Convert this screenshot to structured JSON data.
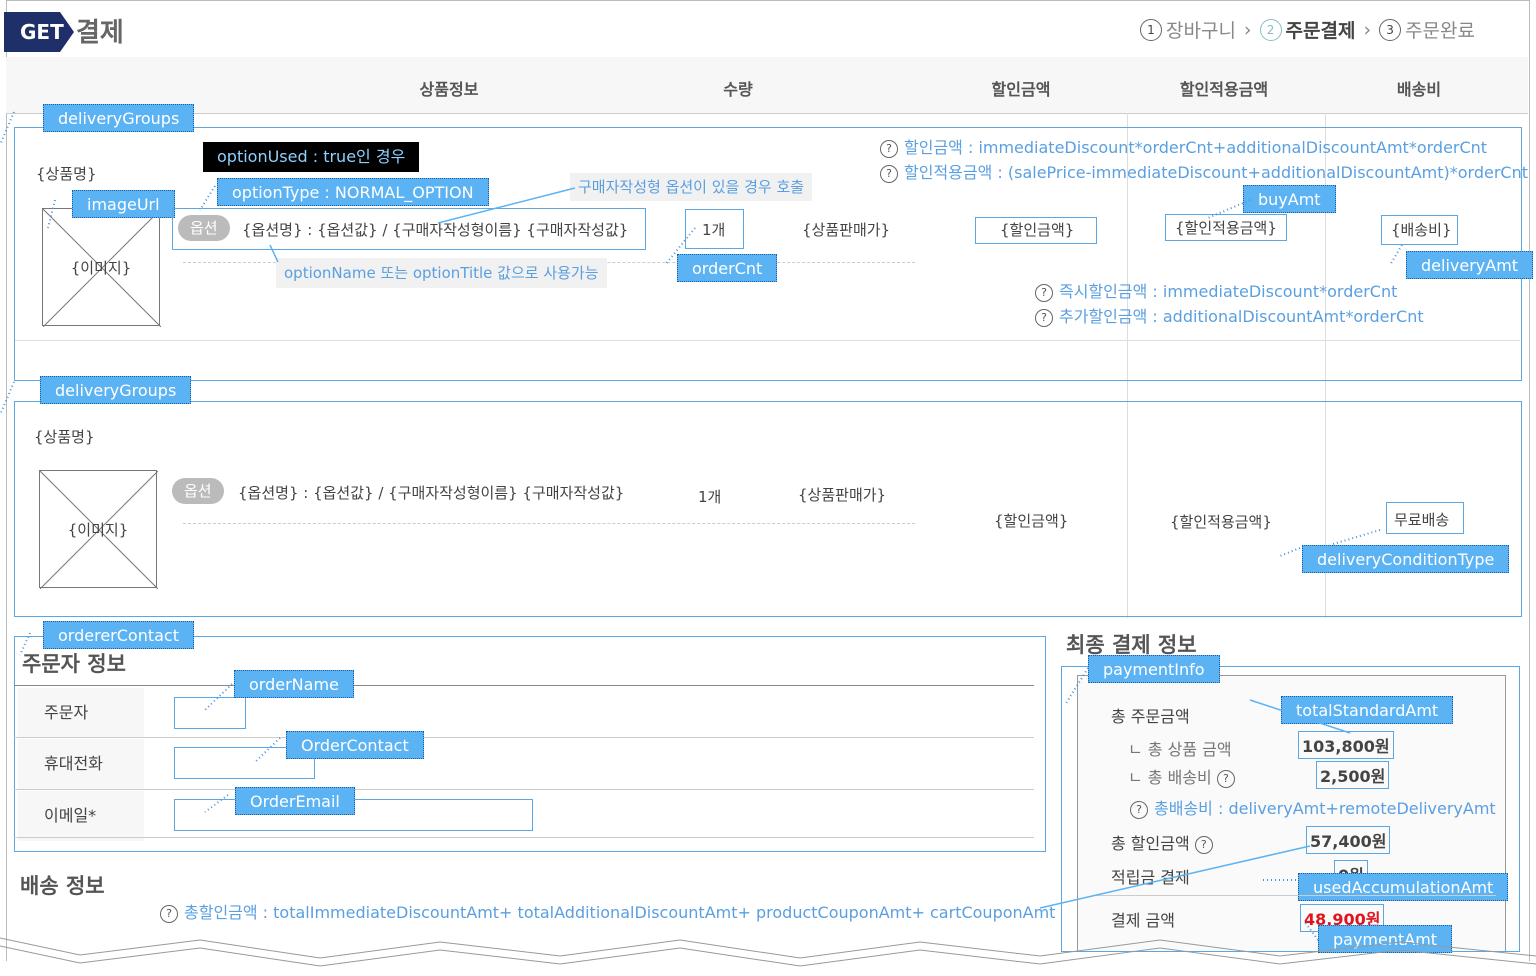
{
  "header": {
    "method_badge": "GET",
    "title": "결제",
    "steps": [
      {
        "num": "1",
        "label": "장바구니"
      },
      {
        "num": "2",
        "label": "주문결제"
      },
      {
        "num": "3",
        "label": "주문완료"
      }
    ]
  },
  "columns": [
    "상품정보",
    "수량",
    "할인금액",
    "할인적용금액",
    "배송비"
  ],
  "group1": {
    "tag": "deliveryGroups",
    "product_name": "{상품명}",
    "image_label": "{이미지}",
    "image_tag": "imageUrl",
    "option_used_note": "optionUsed : true인 경우",
    "option_type_tag": "optionType : NORMAL_OPTION",
    "custom_option_note": "구매자작성형 옵션이 있을 경우 호출",
    "option_pill": "옵션",
    "option_text": "{옵션명} : {옵션값} / {구매자작성형이름} {구매자작성값}",
    "option_name_note": "optionName 또는 optionTitle 값으로 사용가능",
    "qty": "1개",
    "qty_tag": "orderCnt",
    "sale_price": "{상품판매가}",
    "discount": "{할인금액}",
    "applied": "{할인적용금액}",
    "buy_tag": "buyAmt",
    "delivery": "{배송비}",
    "delivery_tag": "deliveryAmt",
    "notes": [
      "할인금액 : immediateDiscount*orderCnt+additionalDiscountAmt*orderCnt",
      "할인적용금액 : (salePrice-immediateDiscount+additionalDiscountAmt)*orderCnt"
    ],
    "discount_notes": [
      "즉시할인금액 : immediateDiscount*orderCnt",
      "추가할인금액 : additionalDiscountAmt*orderCnt"
    ]
  },
  "group2": {
    "tag": "deliveryGroups",
    "product_name": "{상품명}",
    "image_label": "{이미지}",
    "option_pill": "옵션",
    "option_text": "{옵션명} : {옵션값} / {구매자작성형이름} {구매자작성값}",
    "qty": "1개",
    "sale_price": "{상품판매가}",
    "discount": "{할인금액}",
    "applied": "{할인적용금액}",
    "free_delivery": "무료배송",
    "condition_tag": "deliveryConditionType"
  },
  "orderer": {
    "tag": "ordererContact",
    "title": "주문자 정보",
    "rows": [
      {
        "label": "주문자",
        "tag": "orderName"
      },
      {
        "label": "휴대전화",
        "tag": "OrderContact"
      },
      {
        "label": "이메일*",
        "tag": "OrderEmail"
      }
    ]
  },
  "shipping": {
    "title": "배송 정보",
    "total_discount_note": "총할인금액 : totalImmediateDiscountAmt+ totalAdditionalDiscountAmt+ productCouponAmt+ cartCouponAmt"
  },
  "payment": {
    "title": "최종 결제 정보",
    "tag": "paymentInfo",
    "total_order_label": "총 주문금액",
    "total_standard_tag": "totalStandardAmt",
    "product_amount_label": "ㄴ 총 상품 금액",
    "product_amount": "103,800원",
    "delivery_label": "ㄴ 총 배송비",
    "delivery_amount": "2,500원",
    "delivery_note": "총배송비 : deliveryAmt+remoteDeliveryAmt",
    "discount_label": "총 할인금액",
    "discount_amount": "57,400원",
    "accum_label": "적립금 결제",
    "accum_amount": "0원",
    "accum_tag": "usedAccumulationAmt",
    "pay_label": "결제 금액",
    "pay_amount": "48,900원",
    "pay_tag": "paymentAmt",
    "pay_color": "#e0141e"
  }
}
